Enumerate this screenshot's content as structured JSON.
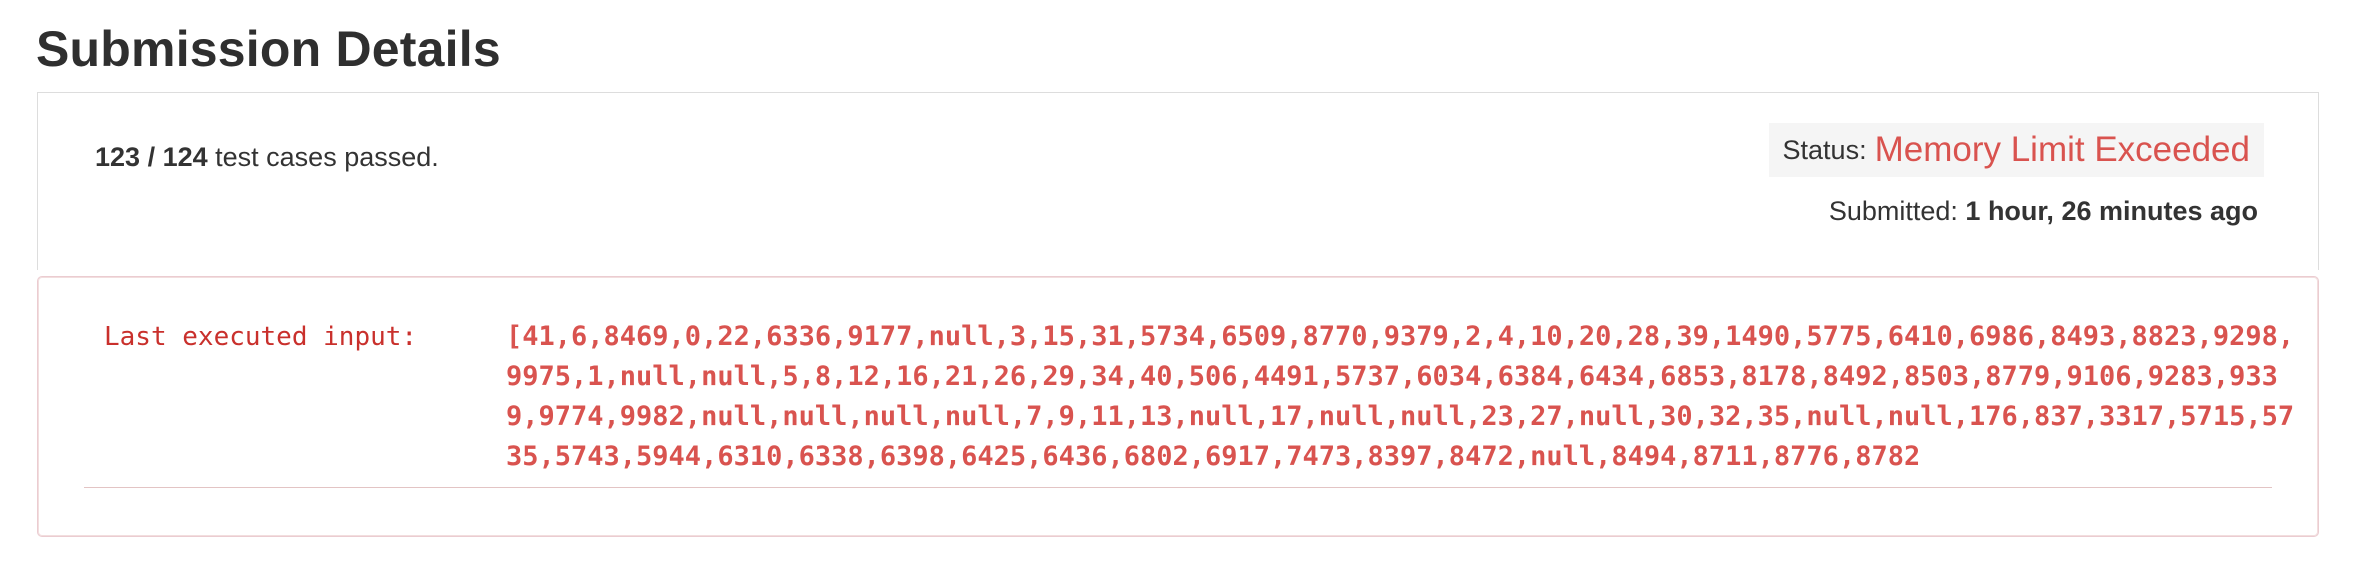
{
  "page": {
    "title": "Submission Details"
  },
  "summary": {
    "passed": "123",
    "separator": " / ",
    "total": "124",
    "cases_text": " test cases passed.",
    "status_label": "Status:",
    "status_value": "Memory Limit Exceeded",
    "submitted_label": "Submitted:",
    "submitted_value": "1 hour, 26 minutes ago"
  },
  "error": {
    "label": "Last executed input:",
    "input": "[41,6,8469,0,22,6336,9177,null,3,15,31,5734,6509,8770,9379,2,4,10,20,28,39,1490,5775,6410,6986,8493,8823,9298,9975,1,null,null,5,8,12,16,21,26,29,34,40,506,4491,5737,6034,6384,6434,6853,8178,8492,8503,8779,9106,9283,9339,9774,9982,null,null,null,null,7,9,11,13,null,17,null,null,23,27,null,30,32,35,null,null,176,837,3317,5715,5735,5743,5944,6310,6338,6398,6425,6436,6802,6917,7473,8397,8472,null,8494,8711,8776,8782"
  },
  "colors": {
    "status_error": "#d9534f",
    "panel_border": "#dddddd",
    "error_border": "#ebccd1",
    "status_bg": "#f5f5f5"
  }
}
